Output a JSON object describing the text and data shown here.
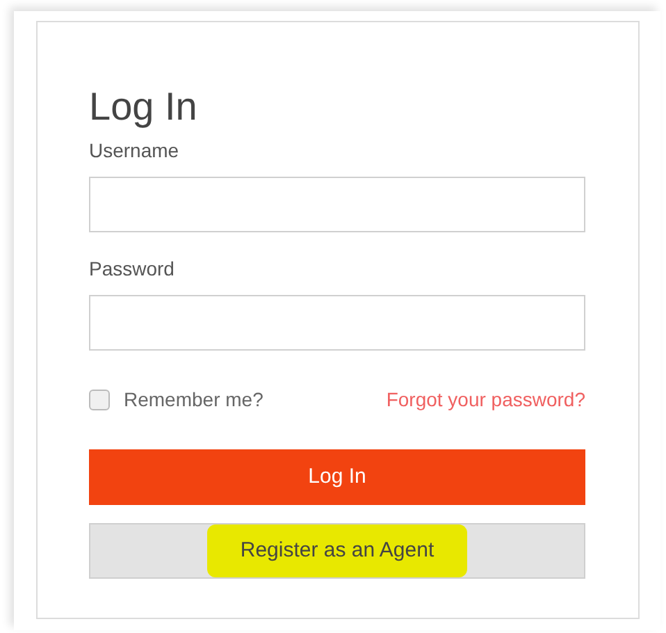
{
  "title": "Log In",
  "fields": [
    {
      "label": "Username"
    },
    {
      "label": "Password"
    }
  ],
  "remember": {
    "label": "Remember me?",
    "checked": false
  },
  "forgot_link": "Forgot your password?",
  "login_button": "Log In",
  "register_button": {
    "label": "Register as an Agent",
    "highlighted": true
  }
}
